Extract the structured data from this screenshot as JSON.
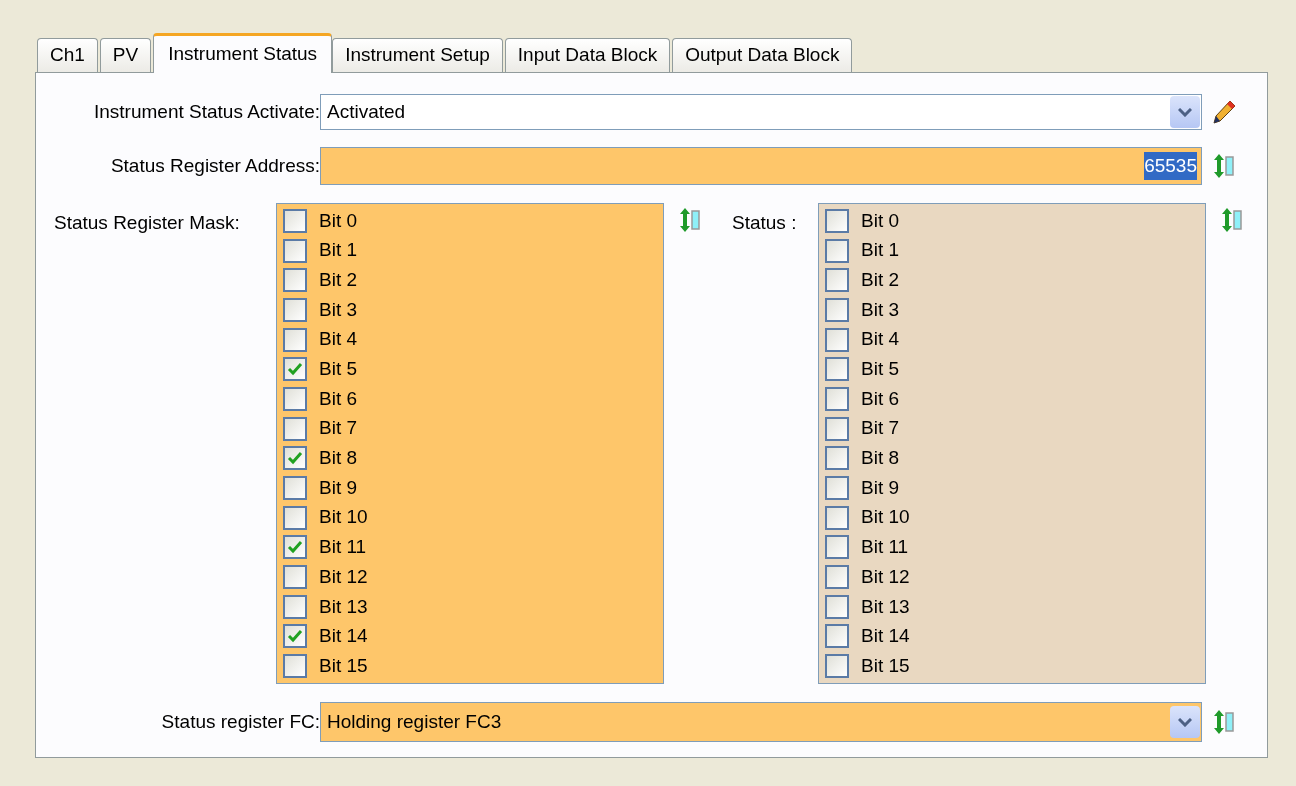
{
  "tabs": [
    {
      "label": "Ch1",
      "selected": false
    },
    {
      "label": "PV",
      "selected": false
    },
    {
      "label": "Instrument Status",
      "selected": true
    },
    {
      "label": "Instrument Setup",
      "selected": false
    },
    {
      "label": "Input Data Block",
      "selected": false
    },
    {
      "label": "Output Data Block",
      "selected": false
    }
  ],
  "activate": {
    "label": "Instrument Status Activate:",
    "value": "Activated"
  },
  "address": {
    "label": "Status Register Address:",
    "value": "65535",
    "text_selected": true
  },
  "mask": {
    "label": "Status Register Mask:",
    "bits": [
      {
        "label": "Bit 0",
        "checked": false
      },
      {
        "label": "Bit 1",
        "checked": false
      },
      {
        "label": "Bit 2",
        "checked": false
      },
      {
        "label": "Bit 3",
        "checked": false
      },
      {
        "label": "Bit 4",
        "checked": false
      },
      {
        "label": "Bit 5",
        "checked": true
      },
      {
        "label": "Bit 6",
        "checked": false
      },
      {
        "label": "Bit 7",
        "checked": false
      },
      {
        "label": "Bit 8",
        "checked": true
      },
      {
        "label": "Bit 9",
        "checked": false
      },
      {
        "label": "Bit 10",
        "checked": false
      },
      {
        "label": "Bit 11",
        "checked": true
      },
      {
        "label": "Bit 12",
        "checked": false
      },
      {
        "label": "Bit 13",
        "checked": false
      },
      {
        "label": "Bit 14",
        "checked": true
      },
      {
        "label": "Bit 15",
        "checked": false
      }
    ]
  },
  "status": {
    "label": "Status :",
    "bits": [
      {
        "label": "Bit 0",
        "checked": false
      },
      {
        "label": "Bit 1",
        "checked": false
      },
      {
        "label": "Bit 2",
        "checked": false
      },
      {
        "label": "Bit 3",
        "checked": false
      },
      {
        "label": "Bit 4",
        "checked": false
      },
      {
        "label": "Bit 5",
        "checked": false
      },
      {
        "label": "Bit 6",
        "checked": false
      },
      {
        "label": "Bit 7",
        "checked": false
      },
      {
        "label": "Bit 8",
        "checked": false
      },
      {
        "label": "Bit 9",
        "checked": false
      },
      {
        "label": "Bit 10",
        "checked": false
      },
      {
        "label": "Bit 11",
        "checked": false
      },
      {
        "label": "Bit 12",
        "checked": false
      },
      {
        "label": "Bit 13",
        "checked": false
      },
      {
        "label": "Bit 14",
        "checked": false
      },
      {
        "label": "Bit 15",
        "checked": false
      }
    ]
  },
  "fc": {
    "label": "Status register FC:",
    "value": "Holding register FC3"
  }
}
